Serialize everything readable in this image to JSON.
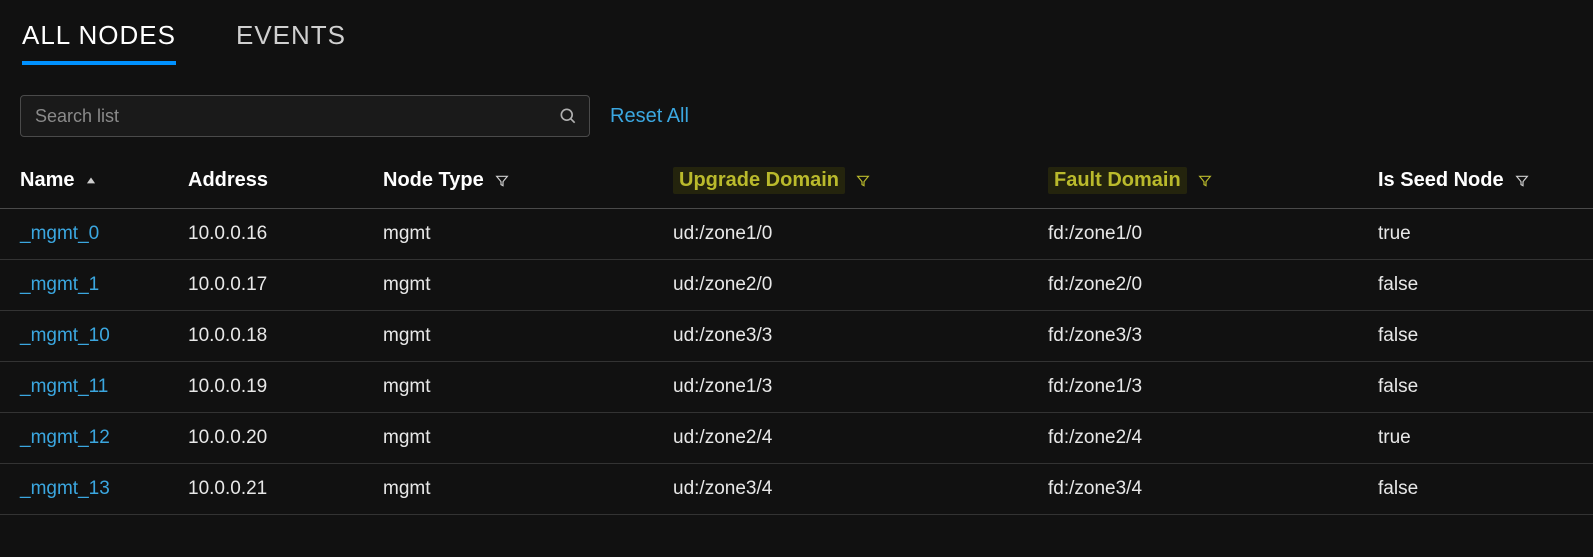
{
  "tabs": {
    "all_nodes": "ALL NODES",
    "events": "EVENTS"
  },
  "search": {
    "placeholder": "Search list"
  },
  "reset_label": "Reset All",
  "columns": {
    "name": "Name",
    "address": "Address",
    "node_type": "Node Type",
    "upgrade_domain": "Upgrade Domain",
    "fault_domain": "Fault Domain",
    "is_seed": "Is Seed Node"
  },
  "rows": [
    {
      "name": "_mgmt_0",
      "address": "10.0.0.16",
      "node_type": "mgmt",
      "upgrade_domain": "ud:/zone1/0",
      "fault_domain": "fd:/zone1/0",
      "is_seed": "true"
    },
    {
      "name": "_mgmt_1",
      "address": "10.0.0.17",
      "node_type": "mgmt",
      "upgrade_domain": "ud:/zone2/0",
      "fault_domain": "fd:/zone2/0",
      "is_seed": "false"
    },
    {
      "name": "_mgmt_10",
      "address": "10.0.0.18",
      "node_type": "mgmt",
      "upgrade_domain": "ud:/zone3/3",
      "fault_domain": "fd:/zone3/3",
      "is_seed": "false"
    },
    {
      "name": "_mgmt_11",
      "address": "10.0.0.19",
      "node_type": "mgmt",
      "upgrade_domain": "ud:/zone1/3",
      "fault_domain": "fd:/zone1/3",
      "is_seed": "false"
    },
    {
      "name": "_mgmt_12",
      "address": "10.0.0.20",
      "node_type": "mgmt",
      "upgrade_domain": "ud:/zone2/4",
      "fault_domain": "fd:/zone2/4",
      "is_seed": "true"
    },
    {
      "name": "_mgmt_13",
      "address": "10.0.0.21",
      "node_type": "mgmt",
      "upgrade_domain": "ud:/zone3/4",
      "fault_domain": "fd:/zone3/4",
      "is_seed": "false"
    }
  ]
}
